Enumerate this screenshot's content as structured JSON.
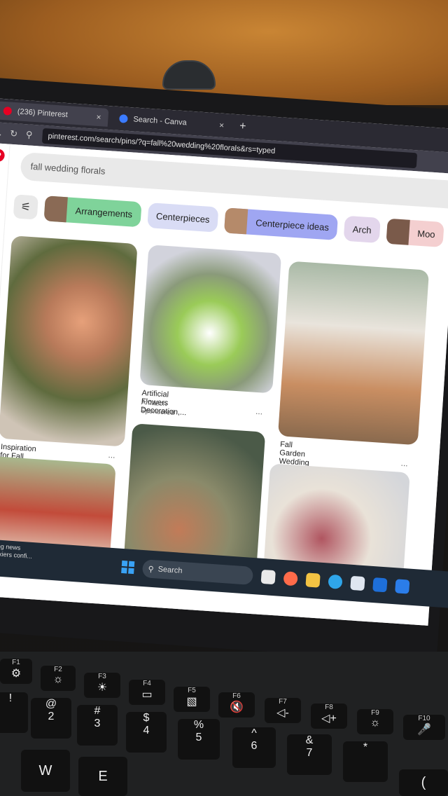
{
  "browser": {
    "tabs": [
      {
        "label": "(236) Pinterest",
        "close": "×",
        "active": true
      },
      {
        "label": "Search - Canva",
        "close": "×",
        "active": false
      }
    ],
    "new_tab": "+",
    "url": "pinterest.com/search/pins/?q=fall%20wedding%20florals&rs=typed"
  },
  "pinterest": {
    "logo": "P",
    "search_value": "fall wedding florals",
    "chips": [
      {
        "label": "Arrangements",
        "color": "#7fd39a"
      },
      {
        "label": "Centerpieces",
        "color": "#d9dcf5"
      },
      {
        "label": "Centerpiece ideas",
        "color": "#9fa6f2"
      },
      {
        "label": "Arch",
        "color": "#e3d6ec"
      },
      {
        "label": "Moo",
        "color": "#f4cfd0"
      }
    ],
    "pins": [
      {
        "title": "Inspiration for Fall Wedding...",
        "subtitle": "",
        "sponsored": ""
      },
      {
        "title": "Artificial Flowers Decoration,...",
        "subtitle": "Amazon",
        "sponsored": "Sponsored"
      },
      {
        "title": "Fall Garden Wedding Vibes",
        "subtitle": "",
        "sponsored": ""
      }
    ],
    "more": "..."
  },
  "taskbar": {
    "news_line1": "king news",
    "news_line2": "t skiers confi...",
    "search_label": "Search"
  },
  "keyboard": {
    "fn_keys": [
      "F1",
      "F2",
      "F3",
      "F4",
      "F5",
      "F6",
      "F7",
      "F8",
      "F9",
      "F10"
    ],
    "number_keys": [
      {
        "top": "!",
        "bottom": ""
      },
      {
        "top": "@",
        "bottom": "2"
      },
      {
        "top": "#",
        "bottom": "3"
      },
      {
        "top": "$",
        "bottom": "4"
      },
      {
        "top": "%",
        "bottom": "5"
      },
      {
        "top": "^",
        "bottom": "6"
      },
      {
        "top": "&",
        "bottom": "7"
      },
      {
        "top": "*",
        "bottom": ""
      }
    ],
    "letter_keys": [
      "W",
      "E",
      "("
    ]
  }
}
